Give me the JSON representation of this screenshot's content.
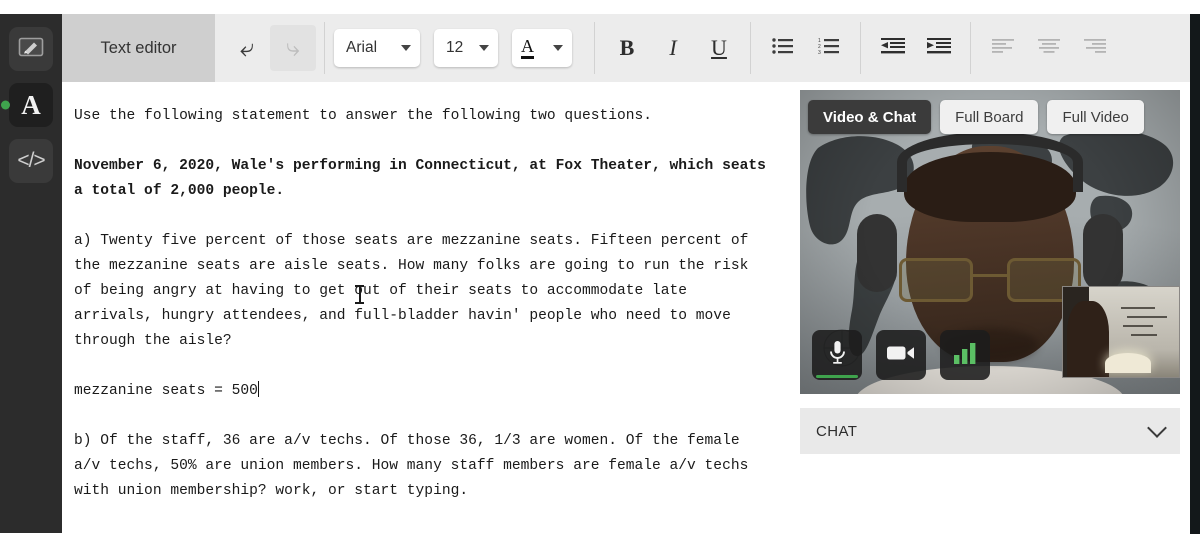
{
  "sidebar": {
    "items": [
      {
        "name": "whiteboard",
        "icon": "whiteboard-pencil-icon",
        "active": false
      },
      {
        "name": "text",
        "icon": "letter-a-icon",
        "active": true,
        "indicator": "#3fa34d"
      },
      {
        "name": "code",
        "icon": "code-brackets-icon",
        "label": "</>",
        "active": false
      }
    ]
  },
  "toolbar": {
    "tab_label": "Text editor",
    "undo_label": "Undo",
    "redo_label": "Redo",
    "font_family": "Arial",
    "font_size": "12",
    "text_color_glyph": "A",
    "bold_label": "B",
    "italic_label": "I",
    "underline_label": "U",
    "bullet_list_label": "Bulleted list",
    "numbered_list_label": "Numbered list",
    "outdent_label": "Decrease indent",
    "indent_label": "Increase indent",
    "align_left_label": "Align left",
    "align_center_label": "Align center",
    "align_right_label": "Align right"
  },
  "document": {
    "blocks": [
      {
        "text": "Use the following statement to answer the following two questions.",
        "bold": false
      },
      {
        "text": "November 6, 2020, Wale's performing in Connecticut, at Fox Theater, which seats a total of 2,000 people.",
        "bold": true
      },
      {
        "text": "a) Twenty five percent of those seats are mezzanine seats. Fifteen percent of the mezzanine seats are aisle seats. How many folks are going to run the risk of being angry at having to get out of their seats to accommodate late arrivals, hungry attendees, and full-bladder havin' people who need to move through the aisle?",
        "bold": false
      },
      {
        "text": "mezzanine seats = 500",
        "bold": false,
        "caret": true
      },
      {
        "text": "b) Of the staff, 36 are a/v techs. Of those 36, 1/3 are women. Of the female a/v techs, 50% are union members. How many staff members are female a/v techs with union membership? work, or start typing.",
        "bold": false
      }
    ]
  },
  "video_panel": {
    "tabs": [
      {
        "label": "Video & Chat",
        "active": true
      },
      {
        "label": "Full Board",
        "active": false
      },
      {
        "label": "Full Video",
        "active": false
      }
    ],
    "controls": [
      {
        "name": "microphone",
        "icon": "microphone-icon",
        "active": true,
        "indicator_color": "#3fa34d"
      },
      {
        "name": "camera",
        "icon": "camera-icon",
        "active": false
      },
      {
        "name": "connection",
        "icon": "signal-bars-icon",
        "color": "#5bbf64"
      }
    ],
    "pip_label": "Self view",
    "chat": {
      "label": "CHAT",
      "collapse_icon": "chevron-down-icon"
    }
  },
  "colors": {
    "sidebar_bg": "#2c2c2c",
    "toolbar_bg": "#ececec",
    "tab_bg": "#cfcfcf",
    "active_tab_bg": "#3b3b3b",
    "accent_green": "#3fa34d",
    "chat_bg": "#e9e9e9"
  }
}
